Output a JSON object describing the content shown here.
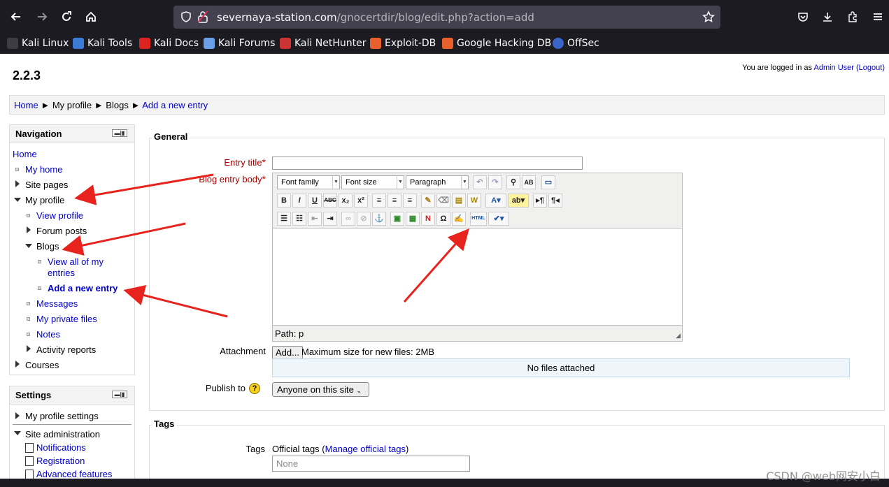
{
  "browser": {
    "url_host": "severnaya-station.com",
    "url_path": "/gnocertdir/blog/edit.php?action=add",
    "bookmarks": [
      "Kali Linux",
      "Kali Tools",
      "Kali Docs",
      "Kali Forums",
      "Kali NetHunter",
      "Exploit-DB",
      "Google Hacking DB",
      "OffSec"
    ]
  },
  "header": {
    "site_title": "2.2.3",
    "login_prefix": "You are logged in as",
    "user_name": "Admin User",
    "logout_label": "(Logout)"
  },
  "breadcrumb": {
    "home": "Home",
    "sep": "►",
    "my_profile": "My profile",
    "blogs": "Blogs",
    "current": "Add a new entry"
  },
  "navigation": {
    "title": "Navigation",
    "home": "Home",
    "my_home": "My home",
    "site_pages": "Site pages",
    "my_profile": "My profile",
    "view_profile": "View profile",
    "forum_posts": "Forum posts",
    "blogs": "Blogs",
    "view_all_line1": "View all of my",
    "view_all_line2": "entries",
    "add_new_entry": "Add a new entry",
    "messages": "Messages",
    "private_files": "My private files",
    "notes": "Notes",
    "activity_reports": "Activity reports",
    "courses": "Courses"
  },
  "settings": {
    "title": "Settings",
    "profile_settings": "My profile settings",
    "site_admin": "Site administration",
    "notifications": "Notifications",
    "registration": "Registration",
    "advanced_features": "Advanced features"
  },
  "form": {
    "general_legend": "General",
    "entry_title_label": "Entry title",
    "entry_title_value": "",
    "body_label": "Blog entry body",
    "font_family": "Font family",
    "font_size": "Font size",
    "paragraph": "Paragraph",
    "path_text": "Path: p",
    "attachment_label": "Attachment",
    "add_button": "Add...",
    "max_size": "Maximum size for new files: 2MB",
    "no_files": "No files attached",
    "publish_label": "Publish to",
    "publish_value": "Anyone on this site",
    "tags_legend": "Tags",
    "tags_label": "Tags",
    "official_tags": "Official tags (",
    "manage_tags": "Manage official tags",
    "close_paren": ")",
    "tags_value": "None"
  },
  "watermark": "CSDN @web网安小白"
}
